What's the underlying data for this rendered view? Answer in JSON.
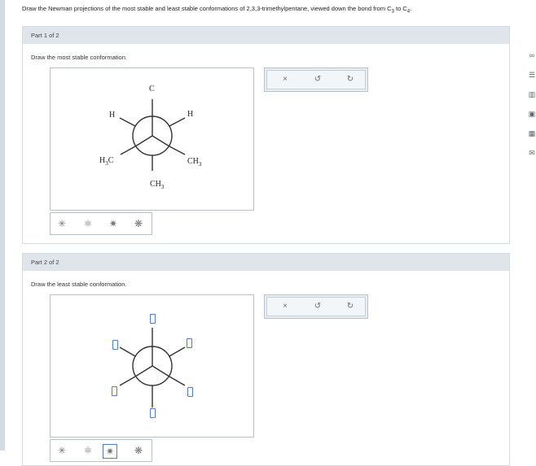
{
  "question": {
    "text": "Draw the Newman projections of the most stable and least stable conformations of 2,3,3-trimethylpentane, viewed down the bond from C",
    "sub1": "3",
    "mid": " to C",
    "sub2": "4",
    "end": "."
  },
  "parts": [
    {
      "header": "Part 1 of 2",
      "prompt": "Draw the most stable conformation.",
      "labels": {
        "top": "C",
        "top_right": "H",
        "top_left": "H",
        "left_main": "H",
        "left_sub": "3",
        "left_tail": "C",
        "right_main": "CH",
        "right_sub": "3",
        "bottom_main": "CH",
        "bottom_sub": "3"
      },
      "toolbar": {
        "close": "×",
        "undo": "↺",
        "redo": "↻"
      }
    },
    {
      "header": "Part 2 of 2",
      "prompt": "Draw the least stable conformation.",
      "toolbar": {
        "close": "×",
        "undo": "↺",
        "redo": "↻"
      }
    }
  ],
  "tool_icons": [
    "newman-staggered-icon",
    "newman-rotate-icon",
    "newman-eclipsed-icon",
    "newman-flip-icon"
  ],
  "side_icons": [
    "infinity-icon",
    "document-icon",
    "chart-icon",
    "image-icon",
    "table-icon",
    "mail-icon"
  ],
  "side_glyphs": [
    "∞",
    "☰",
    "▥",
    "▣",
    "▦",
    "✉"
  ]
}
